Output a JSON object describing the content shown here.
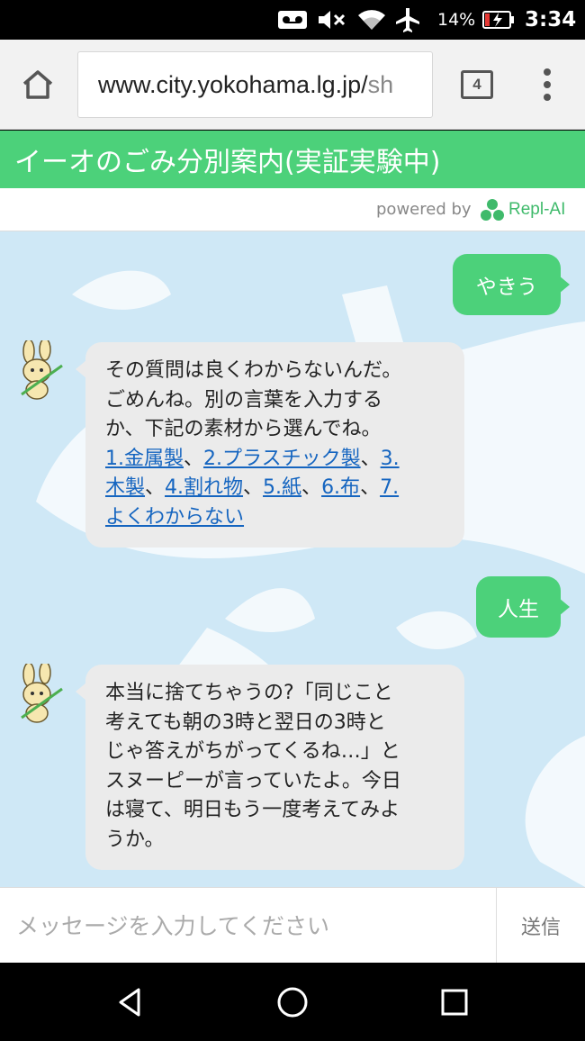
{
  "status_bar": {
    "battery_percent": "14%",
    "time": "3:34",
    "icons": [
      "voicemail-icon",
      "mute-icon",
      "wifi-icon",
      "airplane-icon",
      "battery-charging-icon"
    ]
  },
  "browser": {
    "url_main": "www.city.yokohama.lg.jp/",
    "url_dim": "sh",
    "tab_count": "4"
  },
  "header": {
    "title": "イーオのごみ分別案内(実証実験中)"
  },
  "powered": {
    "label": "powered by",
    "brand": "Repl-AI"
  },
  "messages": [
    {
      "role": "user",
      "text": "やきう"
    },
    {
      "role": "bot",
      "lines": [
        "その質問は良くわからないんだ。",
        "ごめんね。別の言葉を入力する",
        "か、下記の素材から選んでね。"
      ],
      "links": [
        {
          "text": "1.金属製",
          "sep": "、"
        },
        {
          "text": "2.プラスチック製",
          "sep": "、"
        },
        {
          "text": "3.",
          "sep": ""
        },
        {
          "text": "木製",
          "sep": "、"
        },
        {
          "text": "4.割れ物",
          "sep": "、"
        },
        {
          "text": "5.紙",
          "sep": "、"
        },
        {
          "text": "6.布",
          "sep": "、"
        },
        {
          "text": "7.",
          "sep": ""
        },
        {
          "text": "よくわからない",
          "sep": ""
        }
      ]
    },
    {
      "role": "user",
      "text": "人生"
    },
    {
      "role": "bot",
      "lines": [
        "本当に捨てちゃうの?「同じこと",
        "考えても朝の3時と翌日の3時と",
        "じゃ答えがちがってくるね…」と",
        "スヌーピーが言っていたよ。今日",
        "は寝て、明日もう一度考えてみよ",
        "うか。"
      ]
    }
  ],
  "input": {
    "placeholder": "メッセージを入力してください",
    "send_label": "送信"
  },
  "colors": {
    "accent": "#4cd17a",
    "chat_bg": "#cfe8f6",
    "bot_bubble": "#ebebeb",
    "link": "#1565c0"
  }
}
